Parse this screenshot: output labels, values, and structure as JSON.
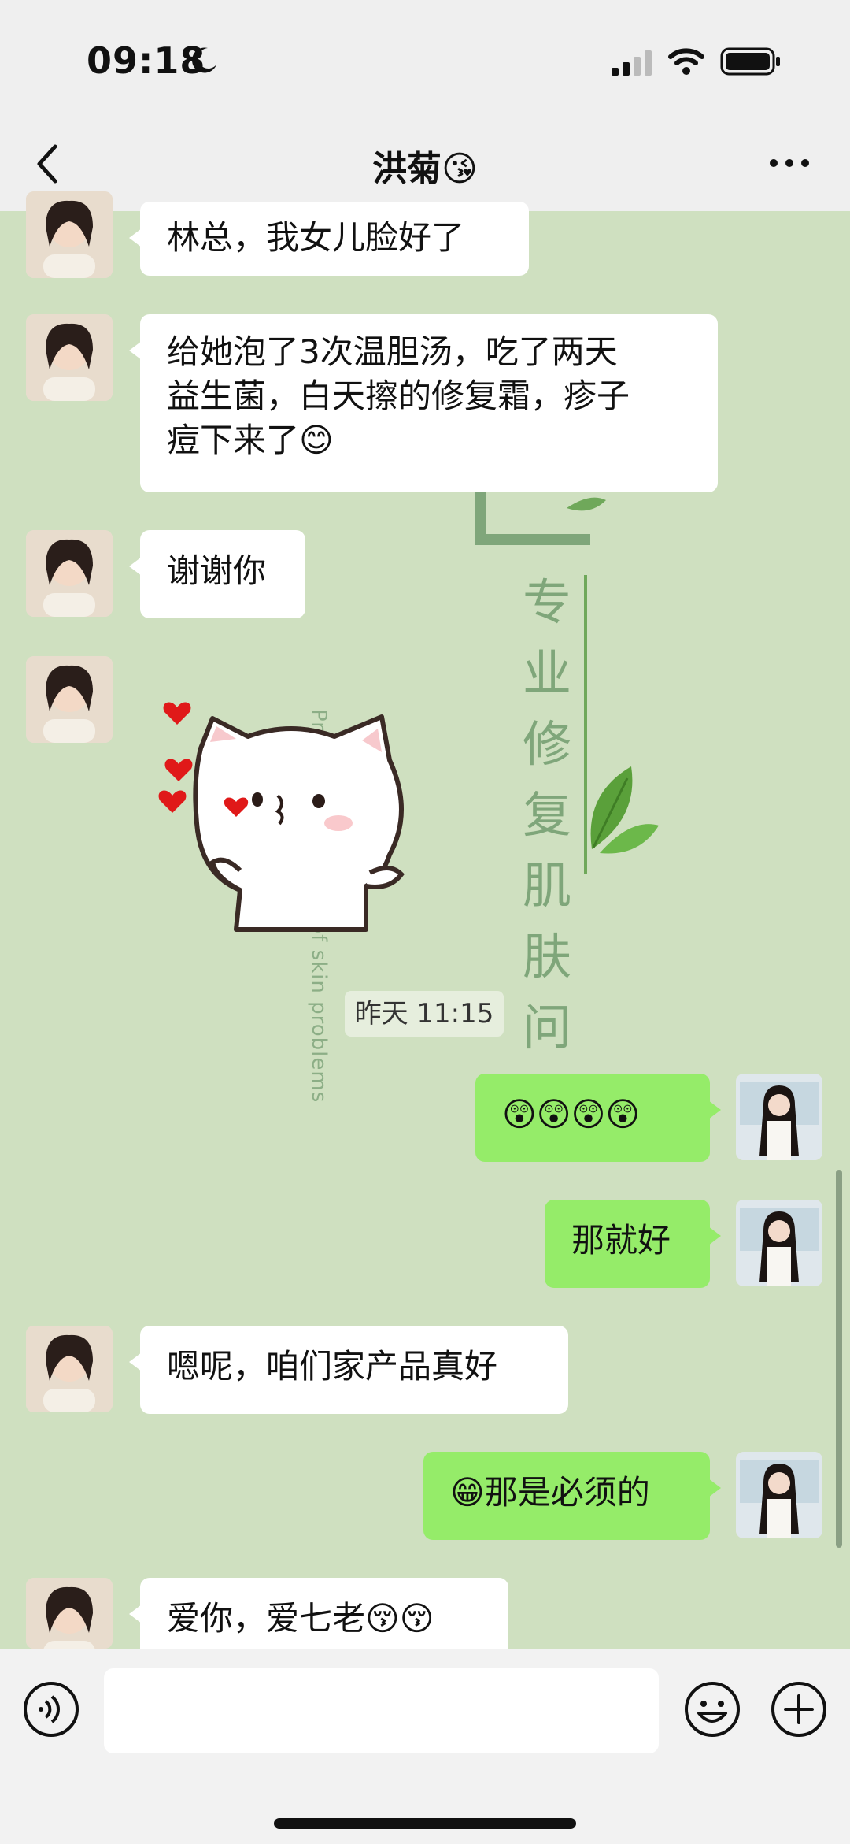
{
  "status_bar": {
    "time": "09:18"
  },
  "nav": {
    "title": "洪菊😘"
  },
  "messages": [
    {
      "side": "other",
      "text": "林总，我女儿脸好了"
    },
    {
      "side": "other",
      "line1": "给她泡了3次温胆汤，吃了两天",
      "line2": "益生菌，白天擦的修复霜，疹子",
      "line3": "痘下来了😊"
    },
    {
      "side": "other",
      "text": "谢谢你"
    },
    {
      "side": "other",
      "type": "sticker"
    },
    {
      "side": "me",
      "text": "😲😲😲😲"
    },
    {
      "side": "me",
      "text": "那就好"
    },
    {
      "side": "other",
      "text": "嗯呢，咱们家产品真好"
    },
    {
      "side": "me",
      "text": "😁那是必须的"
    },
    {
      "side": "other",
      "text": "爱你，爱七老😚😚"
    }
  ],
  "timestamp": "昨天 11:15",
  "watermark": {
    "cn": "专业修复肌肤问题",
    "en": "Professional repair of skin problems"
  },
  "input": {
    "placeholder": ""
  },
  "colors": {
    "chat_bg": "#cfe0c0",
    "my_bubble": "#95ec69",
    "other_bubble": "#ffffff"
  }
}
